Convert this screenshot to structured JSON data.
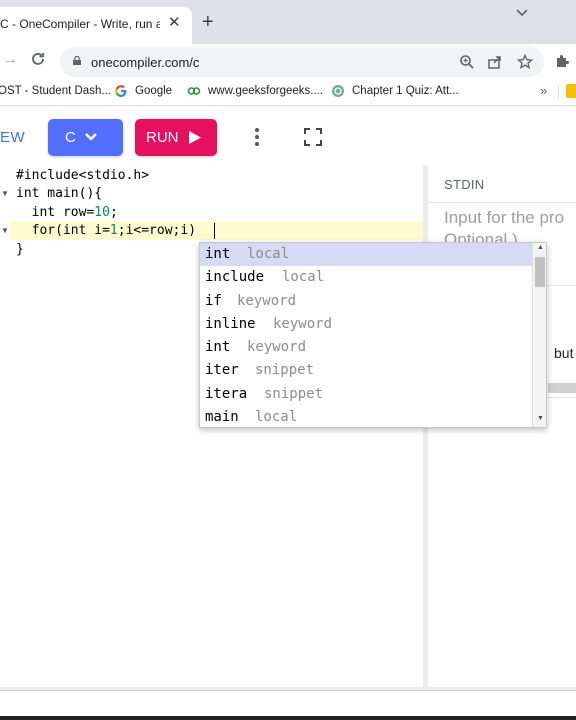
{
  "browser": {
    "tab_title": "C - OneCompiler - Write, run an",
    "tab_close": "✕",
    "new_tab": "+",
    "url": "onecompiler.com/c",
    "bookmarks": [
      {
        "label": "OST - Student Dash...",
        "icon": "student-dash-icon"
      },
      {
        "label": "Google",
        "icon": "google-icon"
      },
      {
        "label": "www.geeksforgeeks....",
        "icon": "geeksforgeeks-icon"
      },
      {
        "label": "Chapter 1 Quiz: Att...",
        "icon": "chatgpt-icon"
      }
    ],
    "bookmarks_more": "»"
  },
  "appbar": {
    "left_partial": "EW",
    "language_label": "C",
    "run_label": "RUN",
    "accent_color": "#536dfe",
    "run_color": "#e5115f"
  },
  "editor": {
    "lines": [
      {
        "text": "#include<stdio.h>"
      },
      {
        "text": "int main(){"
      },
      {
        "pre": "  int row=",
        "num": "10",
        "post": ";"
      },
      {
        "pre": "  for(int i=",
        "num": "1",
        "post": ";i<=row;i)"
      },
      {
        "text": "}"
      }
    ]
  },
  "autocomplete": {
    "items": [
      {
        "word": "int",
        "kind": "local",
        "selected": true
      },
      {
        "word": "include",
        "kind": "local"
      },
      {
        "word": "if",
        "kind": "keyword"
      },
      {
        "word": "inline",
        "kind": "keyword"
      },
      {
        "word": "int",
        "kind": "keyword"
      },
      {
        "word": "iter",
        "kind": "snippet"
      },
      {
        "word": "itera",
        "kind": "snippet"
      },
      {
        "word": "main",
        "kind": "local"
      }
    ]
  },
  "stdin": {
    "title": "STDIN",
    "placeholder_line1": "Input for the pro",
    "placeholder_line2": "Optional )",
    "output_partial": "but"
  }
}
